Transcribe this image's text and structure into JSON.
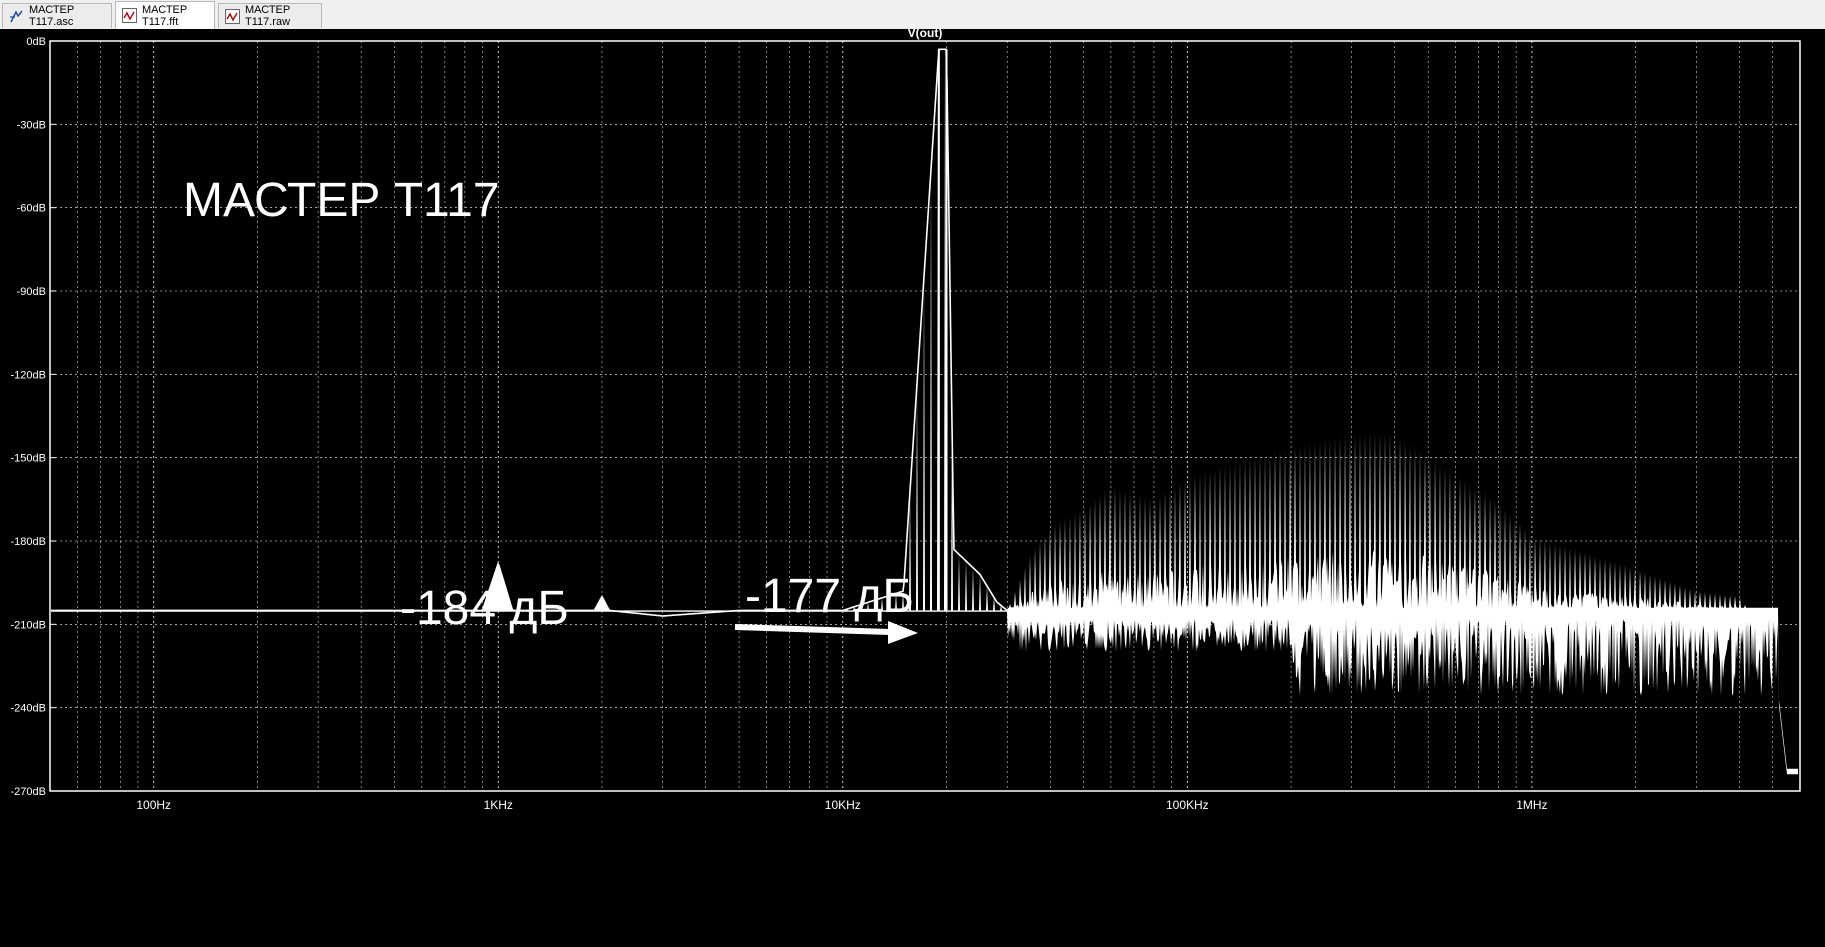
{
  "tabs": [
    {
      "label": "МАСТЕР Т117.asc",
      "icon": "schematic-icon"
    },
    {
      "label": "МАСТЕР Т117.fft",
      "icon": "waveform-icon"
    },
    {
      "label": "МАСТЕР Т117.raw",
      "icon": "waveform-icon"
    }
  ],
  "plot": {
    "trace_label": "V(out)",
    "annotation_title": "МАСТЕР Т117",
    "annotation_peak1": "-184 дБ",
    "annotation_peak2": "-177 дБ",
    "colors": {
      "background": "#000000",
      "trace": "#ffffff",
      "grid": "#ffffff",
      "axis_text": "#ffffff"
    }
  },
  "chart_data": {
    "type": "line",
    "title": "V(out)",
    "x_scale": "log",
    "xlim": [
      50,
      6000000
    ],
    "ylim": [
      -270,
      0
    ],
    "x_ticks": [
      "100Hz",
      "1KHz",
      "10KHz",
      "100KHz",
      "1MHz"
    ],
    "y_ticks": [
      "0dB",
      "-30dB",
      "-60dB",
      "-90dB",
      "-120dB",
      "-150dB",
      "-180dB",
      "-210dB",
      "-240dB",
      "-270dB"
    ],
    "grid": true,
    "noise_floor_db": -205,
    "series": [
      {
        "name": "V(out)",
        "x": [
          50,
          900,
          1000,
          1100,
          1900,
          2000,
          2100,
          3000,
          5000,
          10000,
          15000,
          19000,
          20000,
          21000,
          25000,
          28000,
          30000,
          35000,
          40000,
          50000,
          60000,
          80000,
          100000,
          150000,
          200000,
          300000,
          400000,
          500000,
          800000,
          1000000,
          2000000,
          3000000,
          4000000,
          5000000,
          5500000
        ],
        "y": [
          -205,
          -205,
          -188,
          -205,
          -205,
          -200,
          -205,
          -207,
          -205,
          -205,
          -198,
          -3,
          -3,
          -183,
          -192,
          -202,
          -205,
          -185,
          -175,
          -168,
          -160,
          -165,
          -157,
          -150,
          -146,
          -141,
          -141,
          -149,
          -166,
          -178,
          -190,
          -198,
          -200,
          -218,
          -262
        ]
      }
    ]
  }
}
